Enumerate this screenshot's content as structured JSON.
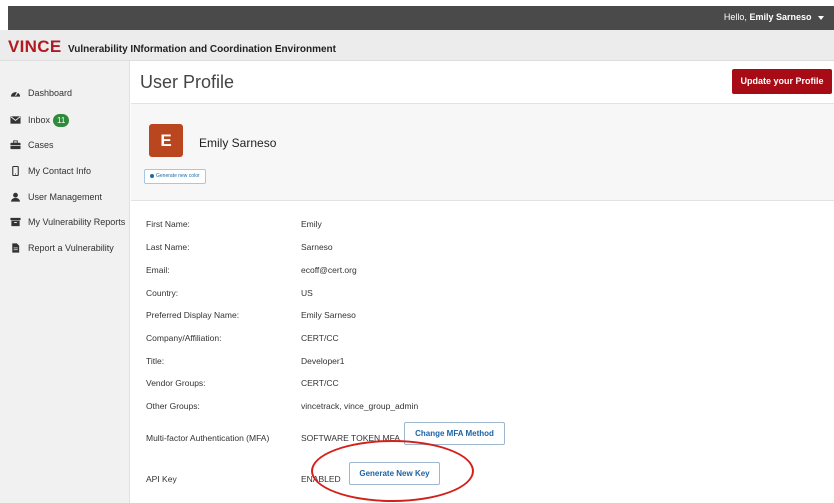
{
  "header": {
    "greeting_prefix": "Hello,",
    "user_name": "Emily Sarneso"
  },
  "brand": {
    "logo": "VINCE",
    "tagline": "Vulnerability INformation and Coordination Environment"
  },
  "sidebar": {
    "items": [
      {
        "label": "Dashboard",
        "icon": "dashboard-icon"
      },
      {
        "label": "Inbox",
        "icon": "envelope-icon",
        "badge": "11"
      },
      {
        "label": "Cases",
        "icon": "briefcase-icon"
      },
      {
        "label": "My Contact Info",
        "icon": "mobile-icon"
      },
      {
        "label": "User Management",
        "icon": "user-icon"
      },
      {
        "label": "My Vulnerability Reports",
        "icon": "archive-icon"
      },
      {
        "label": "Report a Vulnerability",
        "icon": "document-icon"
      }
    ]
  },
  "main": {
    "title": "User Profile",
    "update_button": "Update your Profile",
    "avatar_letter": "E",
    "avatar_color": "#b9461f",
    "display_name": "Emily Sarneso",
    "color_button": "Generate new color",
    "fields": [
      {
        "label": "First Name:",
        "value": "Emily"
      },
      {
        "label": "Last Name:",
        "value": "Sarneso"
      },
      {
        "label": "Email:",
        "value": "ecoff@cert.org"
      },
      {
        "label": "Country:",
        "value": "US"
      },
      {
        "label": "Preferred Display Name:",
        "value": "Emily Sarneso"
      },
      {
        "label": "Company/Affiliation:",
        "value": "CERT/CC"
      },
      {
        "label": "Title:",
        "value": "Developer1"
      },
      {
        "label": "Vendor Groups:",
        "value": "CERT/CC"
      },
      {
        "label": "Other Groups:",
        "value": "vincetrack, vince_group_admin"
      },
      {
        "label": "Multi-factor Authentication (MFA)",
        "value": "SOFTWARE TOKEN MFA"
      },
      {
        "label": "API Key",
        "value": "ENABLED"
      }
    ],
    "mfa_button": "Change MFA Method",
    "api_button": "Generate New Key"
  },
  "colors": {
    "brand_red": "#b01b21",
    "button_red": "#a70c16",
    "badge_green": "#2f8a3b",
    "link_blue": "#1c63a5"
  }
}
